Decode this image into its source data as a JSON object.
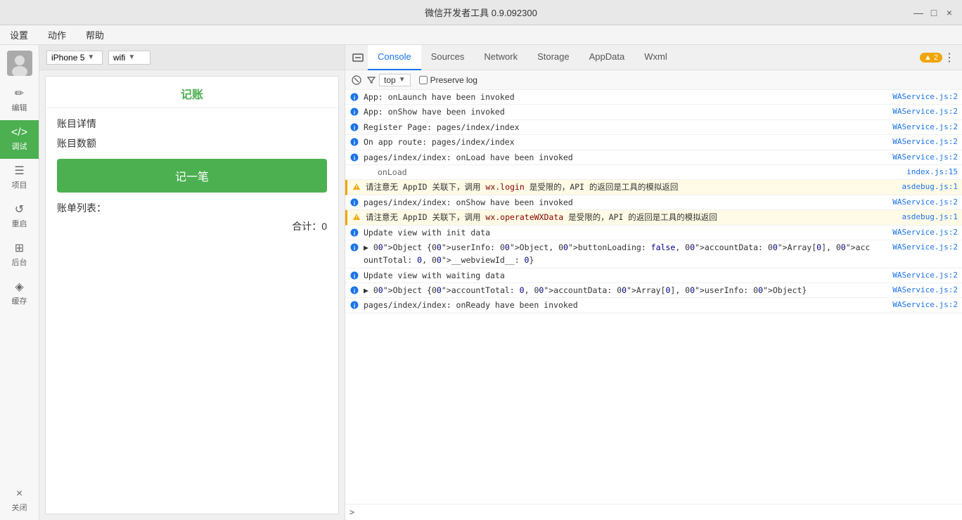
{
  "titlebar": {
    "title": "微信开发者工具 0.9.092300",
    "minimize": "—",
    "maximize": "□",
    "close": "×"
  },
  "menubar": {
    "items": [
      "设置",
      "动作",
      "帮助"
    ]
  },
  "sidebar": {
    "avatar_color": "#888",
    "items": [
      {
        "id": "edit",
        "icon": "✏",
        "label": "编辑"
      },
      {
        "id": "debug",
        "icon": "</>",
        "label": "调试",
        "active": true
      },
      {
        "id": "project",
        "icon": "☰",
        "label": "项目"
      },
      {
        "id": "restart",
        "icon": "↺",
        "label": "重启"
      },
      {
        "id": "backend",
        "icon": "⊞",
        "label": "后台"
      },
      {
        "id": "cache",
        "icon": "◈",
        "label": "缓存"
      },
      {
        "id": "close",
        "icon": "×",
        "label": "关闭"
      }
    ]
  },
  "device_bar": {
    "device": "iPhone 5",
    "network": "wifi"
  },
  "app": {
    "title": "记账",
    "section_detail": "账目详情",
    "section_amount": "账目数额",
    "record_button": "记一笔",
    "bill_list_label": "账单列表：",
    "bill_total": "合计：0"
  },
  "devtools": {
    "tabs": [
      {
        "id": "console-icon",
        "label": ""
      },
      {
        "id": "console",
        "label": "Console",
        "active": true
      },
      {
        "id": "sources",
        "label": "Sources"
      },
      {
        "id": "network",
        "label": "Network"
      },
      {
        "id": "storage",
        "label": "Storage"
      },
      {
        "id": "appdata",
        "label": "AppData"
      },
      {
        "id": "wxml",
        "label": "Wxml"
      }
    ],
    "toolbar": {
      "context": "top",
      "preserve_log": "Preserve log",
      "warning_count": "▲ 2"
    },
    "logs": [
      {
        "type": "info",
        "text": "App: onLaunch have been invoked",
        "source": "WAService.js:2"
      },
      {
        "type": "info",
        "text": "App: onShow have been invoked",
        "source": "WAService.js:2"
      },
      {
        "type": "info",
        "text": "Register Page: pages/index/index",
        "source": "WAService.js:2"
      },
      {
        "type": "info",
        "text": "On app route: pages/index/index",
        "source": "WAService.js:2"
      },
      {
        "type": "info",
        "text": "pages/index/index: onLoad have been invoked",
        "source": "WAService.js:2"
      },
      {
        "type": "indent",
        "text": "onLoad",
        "source": "index.js:15"
      },
      {
        "type": "warn",
        "text": "请注意无 AppID 关联下，调用 wx.login 是受限的，API 的返回是工具的模拟返回",
        "source": "asdebug.js:1",
        "has_code": true,
        "code": "wx.login"
      },
      {
        "type": "info",
        "text": "pages/index/index: onShow have been invoked",
        "source": "WAService.js:2"
      },
      {
        "type": "warn",
        "text": "请注意无 AppID 关联下，调用 wx.operateWXData 是受限的，API 的返回是工具的模拟返回",
        "source": "asdebug.js:1",
        "has_code": true,
        "code": "wx.operateWXData"
      },
      {
        "type": "info",
        "text": "Update view with init data",
        "source": "WAService.js:2"
      },
      {
        "type": "info",
        "text": "▶ Object {userInfo: Object, buttonLoading: false, accountData: Array[0], accountTotal: 0, __webviewId__: 0}",
        "source": "WAService.js:2",
        "is_object": true
      },
      {
        "type": "info",
        "text": "Update view with waiting data",
        "source": "WAService.js:2"
      },
      {
        "type": "info",
        "text": "▶ Object {accountTotal: 0, accountData: Array[0], userInfo: Object}",
        "source": "WAService.js:2",
        "is_object": true
      },
      {
        "type": "info",
        "text": "pages/index/index: onReady have been invoked",
        "source": "WAService.js:2"
      }
    ]
  }
}
